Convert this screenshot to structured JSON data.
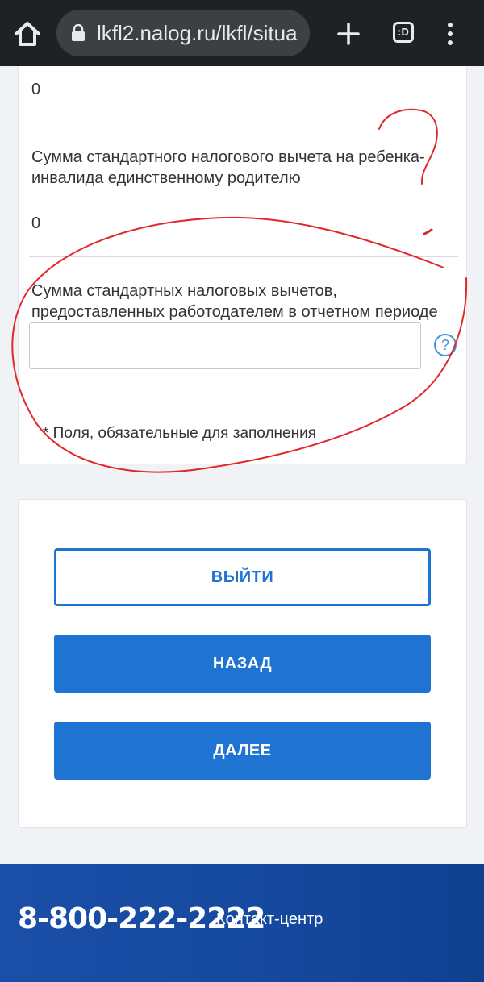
{
  "browser": {
    "url": "lkfl2.nalog.ru/lkfl/situa",
    "tabs_label": ":D"
  },
  "form": {
    "value_top": "0",
    "field_child_disabled_label": "Сумма стандартного налогового вычета на ребенка-инвалида единственному родителю",
    "field_child_disabled_value": "0",
    "field_employer_label": "Сумма стандартных налоговых вычетов, предоставленных работодателем в отчетном периоде",
    "field_employer_value": "",
    "help_icon": "?",
    "required_note": "* Поля, обязательные для заполнения"
  },
  "buttons": {
    "exit_label": "ВЫЙТИ",
    "back_label": "НАЗАД",
    "next_label": "ДАЛЕЕ"
  },
  "footer": {
    "phone": "8-800-222-2222",
    "contact_label": "Контакт-центр"
  },
  "colors": {
    "primary": "#1f74d3",
    "footer": "#164aa0",
    "annotation": "#e0282e"
  }
}
